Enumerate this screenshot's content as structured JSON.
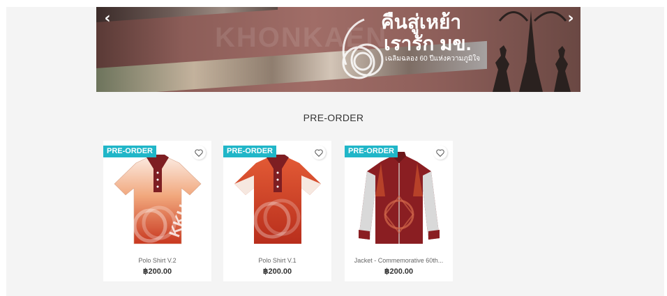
{
  "banner": {
    "ghost_text": "KHONKAEN",
    "title_line1": "คืนสู่เหย้า",
    "title_line2": "เรารัก มข.",
    "title_line3": "เฉลิมฉลอง 60 ปีแห่งความภูมิใจ",
    "logo_number": "60",
    "prev_icon": "chevron-left-icon",
    "next_icon": "chevron-right-icon"
  },
  "section": {
    "title": "PRE-ORDER"
  },
  "products": [
    {
      "badge": "PRE-ORDER",
      "name": "Polo Shirt V.2",
      "price": "฿200.00",
      "wish_icon": "heart-icon"
    },
    {
      "badge": "PRE-ORDER",
      "name": "Polo Shirt V.1",
      "price": "฿200.00",
      "wish_icon": "heart-icon"
    },
    {
      "badge": "PRE-ORDER",
      "name": "Jacket - Commemorative 60th...",
      "price": "฿200.00",
      "wish_icon": "heart-icon"
    }
  ],
  "colors": {
    "badge": "#20b6c8",
    "page_bg": "#f4f4f4",
    "banner": "#8c5d58",
    "maroon": "#8a1e22",
    "orange": "#d9532b"
  }
}
